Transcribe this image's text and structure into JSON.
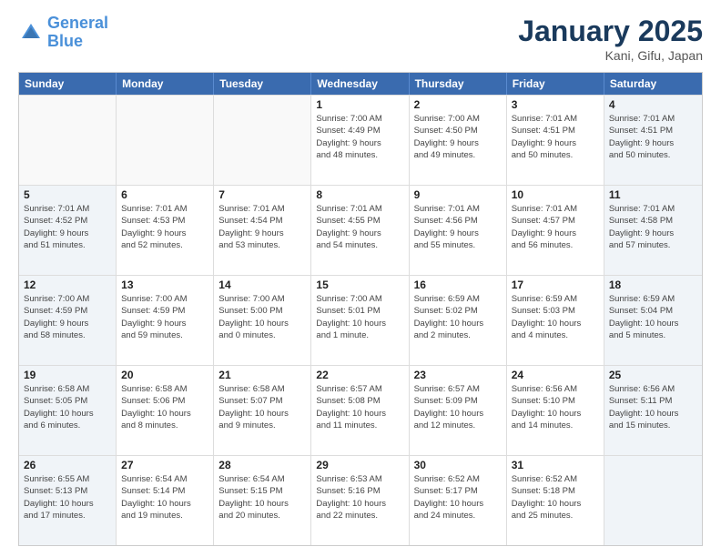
{
  "header": {
    "logo_line1": "General",
    "logo_line2": "Blue",
    "month_title": "January 2025",
    "location": "Kani, Gifu, Japan"
  },
  "weekdays": [
    "Sunday",
    "Monday",
    "Tuesday",
    "Wednesday",
    "Thursday",
    "Friday",
    "Saturday"
  ],
  "rows": [
    [
      {
        "day": "",
        "info": "",
        "shaded": false
      },
      {
        "day": "",
        "info": "",
        "shaded": false
      },
      {
        "day": "",
        "info": "",
        "shaded": false
      },
      {
        "day": "1",
        "info": "Sunrise: 7:00 AM\nSunset: 4:49 PM\nDaylight: 9 hours\nand 48 minutes.",
        "shaded": false
      },
      {
        "day": "2",
        "info": "Sunrise: 7:00 AM\nSunset: 4:50 PM\nDaylight: 9 hours\nand 49 minutes.",
        "shaded": false
      },
      {
        "day": "3",
        "info": "Sunrise: 7:01 AM\nSunset: 4:51 PM\nDaylight: 9 hours\nand 50 minutes.",
        "shaded": false
      },
      {
        "day": "4",
        "info": "Sunrise: 7:01 AM\nSunset: 4:51 PM\nDaylight: 9 hours\nand 50 minutes.",
        "shaded": true
      }
    ],
    [
      {
        "day": "5",
        "info": "Sunrise: 7:01 AM\nSunset: 4:52 PM\nDaylight: 9 hours\nand 51 minutes.",
        "shaded": true
      },
      {
        "day": "6",
        "info": "Sunrise: 7:01 AM\nSunset: 4:53 PM\nDaylight: 9 hours\nand 52 minutes.",
        "shaded": false
      },
      {
        "day": "7",
        "info": "Sunrise: 7:01 AM\nSunset: 4:54 PM\nDaylight: 9 hours\nand 53 minutes.",
        "shaded": false
      },
      {
        "day": "8",
        "info": "Sunrise: 7:01 AM\nSunset: 4:55 PM\nDaylight: 9 hours\nand 54 minutes.",
        "shaded": false
      },
      {
        "day": "9",
        "info": "Sunrise: 7:01 AM\nSunset: 4:56 PM\nDaylight: 9 hours\nand 55 minutes.",
        "shaded": false
      },
      {
        "day": "10",
        "info": "Sunrise: 7:01 AM\nSunset: 4:57 PM\nDaylight: 9 hours\nand 56 minutes.",
        "shaded": false
      },
      {
        "day": "11",
        "info": "Sunrise: 7:01 AM\nSunset: 4:58 PM\nDaylight: 9 hours\nand 57 minutes.",
        "shaded": true
      }
    ],
    [
      {
        "day": "12",
        "info": "Sunrise: 7:00 AM\nSunset: 4:59 PM\nDaylight: 9 hours\nand 58 minutes.",
        "shaded": true
      },
      {
        "day": "13",
        "info": "Sunrise: 7:00 AM\nSunset: 4:59 PM\nDaylight: 9 hours\nand 59 minutes.",
        "shaded": false
      },
      {
        "day": "14",
        "info": "Sunrise: 7:00 AM\nSunset: 5:00 PM\nDaylight: 10 hours\nand 0 minutes.",
        "shaded": false
      },
      {
        "day": "15",
        "info": "Sunrise: 7:00 AM\nSunset: 5:01 PM\nDaylight: 10 hours\nand 1 minute.",
        "shaded": false
      },
      {
        "day": "16",
        "info": "Sunrise: 6:59 AM\nSunset: 5:02 PM\nDaylight: 10 hours\nand 2 minutes.",
        "shaded": false
      },
      {
        "day": "17",
        "info": "Sunrise: 6:59 AM\nSunset: 5:03 PM\nDaylight: 10 hours\nand 4 minutes.",
        "shaded": false
      },
      {
        "day": "18",
        "info": "Sunrise: 6:59 AM\nSunset: 5:04 PM\nDaylight: 10 hours\nand 5 minutes.",
        "shaded": true
      }
    ],
    [
      {
        "day": "19",
        "info": "Sunrise: 6:58 AM\nSunset: 5:05 PM\nDaylight: 10 hours\nand 6 minutes.",
        "shaded": true
      },
      {
        "day": "20",
        "info": "Sunrise: 6:58 AM\nSunset: 5:06 PM\nDaylight: 10 hours\nand 8 minutes.",
        "shaded": false
      },
      {
        "day": "21",
        "info": "Sunrise: 6:58 AM\nSunset: 5:07 PM\nDaylight: 10 hours\nand 9 minutes.",
        "shaded": false
      },
      {
        "day": "22",
        "info": "Sunrise: 6:57 AM\nSunset: 5:08 PM\nDaylight: 10 hours\nand 11 minutes.",
        "shaded": false
      },
      {
        "day": "23",
        "info": "Sunrise: 6:57 AM\nSunset: 5:09 PM\nDaylight: 10 hours\nand 12 minutes.",
        "shaded": false
      },
      {
        "day": "24",
        "info": "Sunrise: 6:56 AM\nSunset: 5:10 PM\nDaylight: 10 hours\nand 14 minutes.",
        "shaded": false
      },
      {
        "day": "25",
        "info": "Sunrise: 6:56 AM\nSunset: 5:11 PM\nDaylight: 10 hours\nand 15 minutes.",
        "shaded": true
      }
    ],
    [
      {
        "day": "26",
        "info": "Sunrise: 6:55 AM\nSunset: 5:13 PM\nDaylight: 10 hours\nand 17 minutes.",
        "shaded": true
      },
      {
        "day": "27",
        "info": "Sunrise: 6:54 AM\nSunset: 5:14 PM\nDaylight: 10 hours\nand 19 minutes.",
        "shaded": false
      },
      {
        "day": "28",
        "info": "Sunrise: 6:54 AM\nSunset: 5:15 PM\nDaylight: 10 hours\nand 20 minutes.",
        "shaded": false
      },
      {
        "day": "29",
        "info": "Sunrise: 6:53 AM\nSunset: 5:16 PM\nDaylight: 10 hours\nand 22 minutes.",
        "shaded": false
      },
      {
        "day": "30",
        "info": "Sunrise: 6:52 AM\nSunset: 5:17 PM\nDaylight: 10 hours\nand 24 minutes.",
        "shaded": false
      },
      {
        "day": "31",
        "info": "Sunrise: 6:52 AM\nSunset: 5:18 PM\nDaylight: 10 hours\nand 25 minutes.",
        "shaded": false
      },
      {
        "day": "",
        "info": "",
        "shaded": true
      }
    ]
  ]
}
